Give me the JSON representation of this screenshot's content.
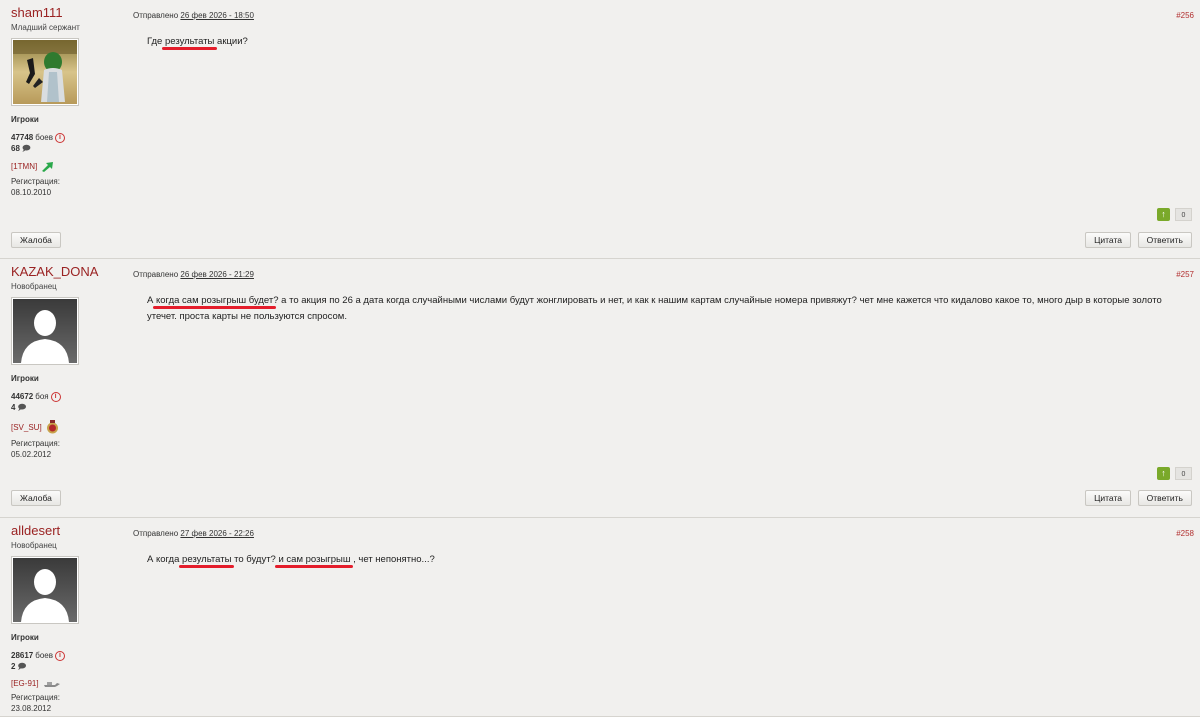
{
  "posts": [
    {
      "username": "sham111",
      "rank": "Младший сержант",
      "group": "Игроки",
      "battles_count": "47748",
      "battles_label": "боев",
      "messages": "68",
      "clan": "[1TMN]",
      "reg_label": "Регистрация:",
      "reg_date": "08.10.2010",
      "meta_prefix": "Отправлено",
      "date": "26 фев 2026 - 18:50",
      "number": "#256",
      "content": [
        {
          "text": "Где "
        },
        {
          "text": "результаты",
          "hl": true
        },
        {
          "text": " акции?"
        }
      ],
      "votes": "0",
      "avatar": "custom"
    },
    {
      "username": "KAZAK_DONA",
      "rank": "Новобранец",
      "group": "Игроки",
      "battles_count": "44672",
      "battles_label": "боя",
      "messages": "4",
      "clan": "[SV_SU]",
      "reg_label": "Регистрация:",
      "reg_date": "05.02.2012",
      "meta_prefix": "Отправлено",
      "date": "26 фев 2026 - 21:29",
      "number": "#257",
      "content": [
        {
          "text": "А "
        },
        {
          "text": "когда сам розыгрыш будет",
          "hl": true
        },
        {
          "text": "? а то акция по 26 а дата когда случайными числами будут жонглировать и нет, и как к нашим картам случайные номера привяжут? чет мне кажется что кидалово какое то, много дыр в которые золото утечет. проста карты не пользуются спросом."
        }
      ],
      "votes": "0",
      "avatar": "default"
    },
    {
      "username": "alldesert",
      "rank": "Новобранец",
      "group": "Игроки",
      "battles_count": "28617",
      "battles_label": "боев",
      "messages": "2",
      "clan": "[EG-91]",
      "reg_label": "Регистрация:",
      "reg_date": "23.08.2012",
      "meta_prefix": "Отправлено",
      "date": "27 фев 2026 - 22:26",
      "number": "#258",
      "content": [
        {
          "text": "А когда "
        },
        {
          "text": "результаты",
          "hl": true
        },
        {
          "text": " то будут? "
        },
        {
          "text": "и сам розыгрыш",
          "hl": true
        },
        {
          "text": " , чет непонятно...?"
        }
      ],
      "votes": "0",
      "avatar": "default"
    }
  ],
  "buttons": {
    "report": "Жалоба",
    "quote": "Цитата",
    "reply": "Ответить"
  },
  "colors": {
    "username": "#9a2222",
    "highlight": "#e41d2b",
    "post_bg": "#f1f0ee",
    "vote_up": "#7aa92a"
  }
}
